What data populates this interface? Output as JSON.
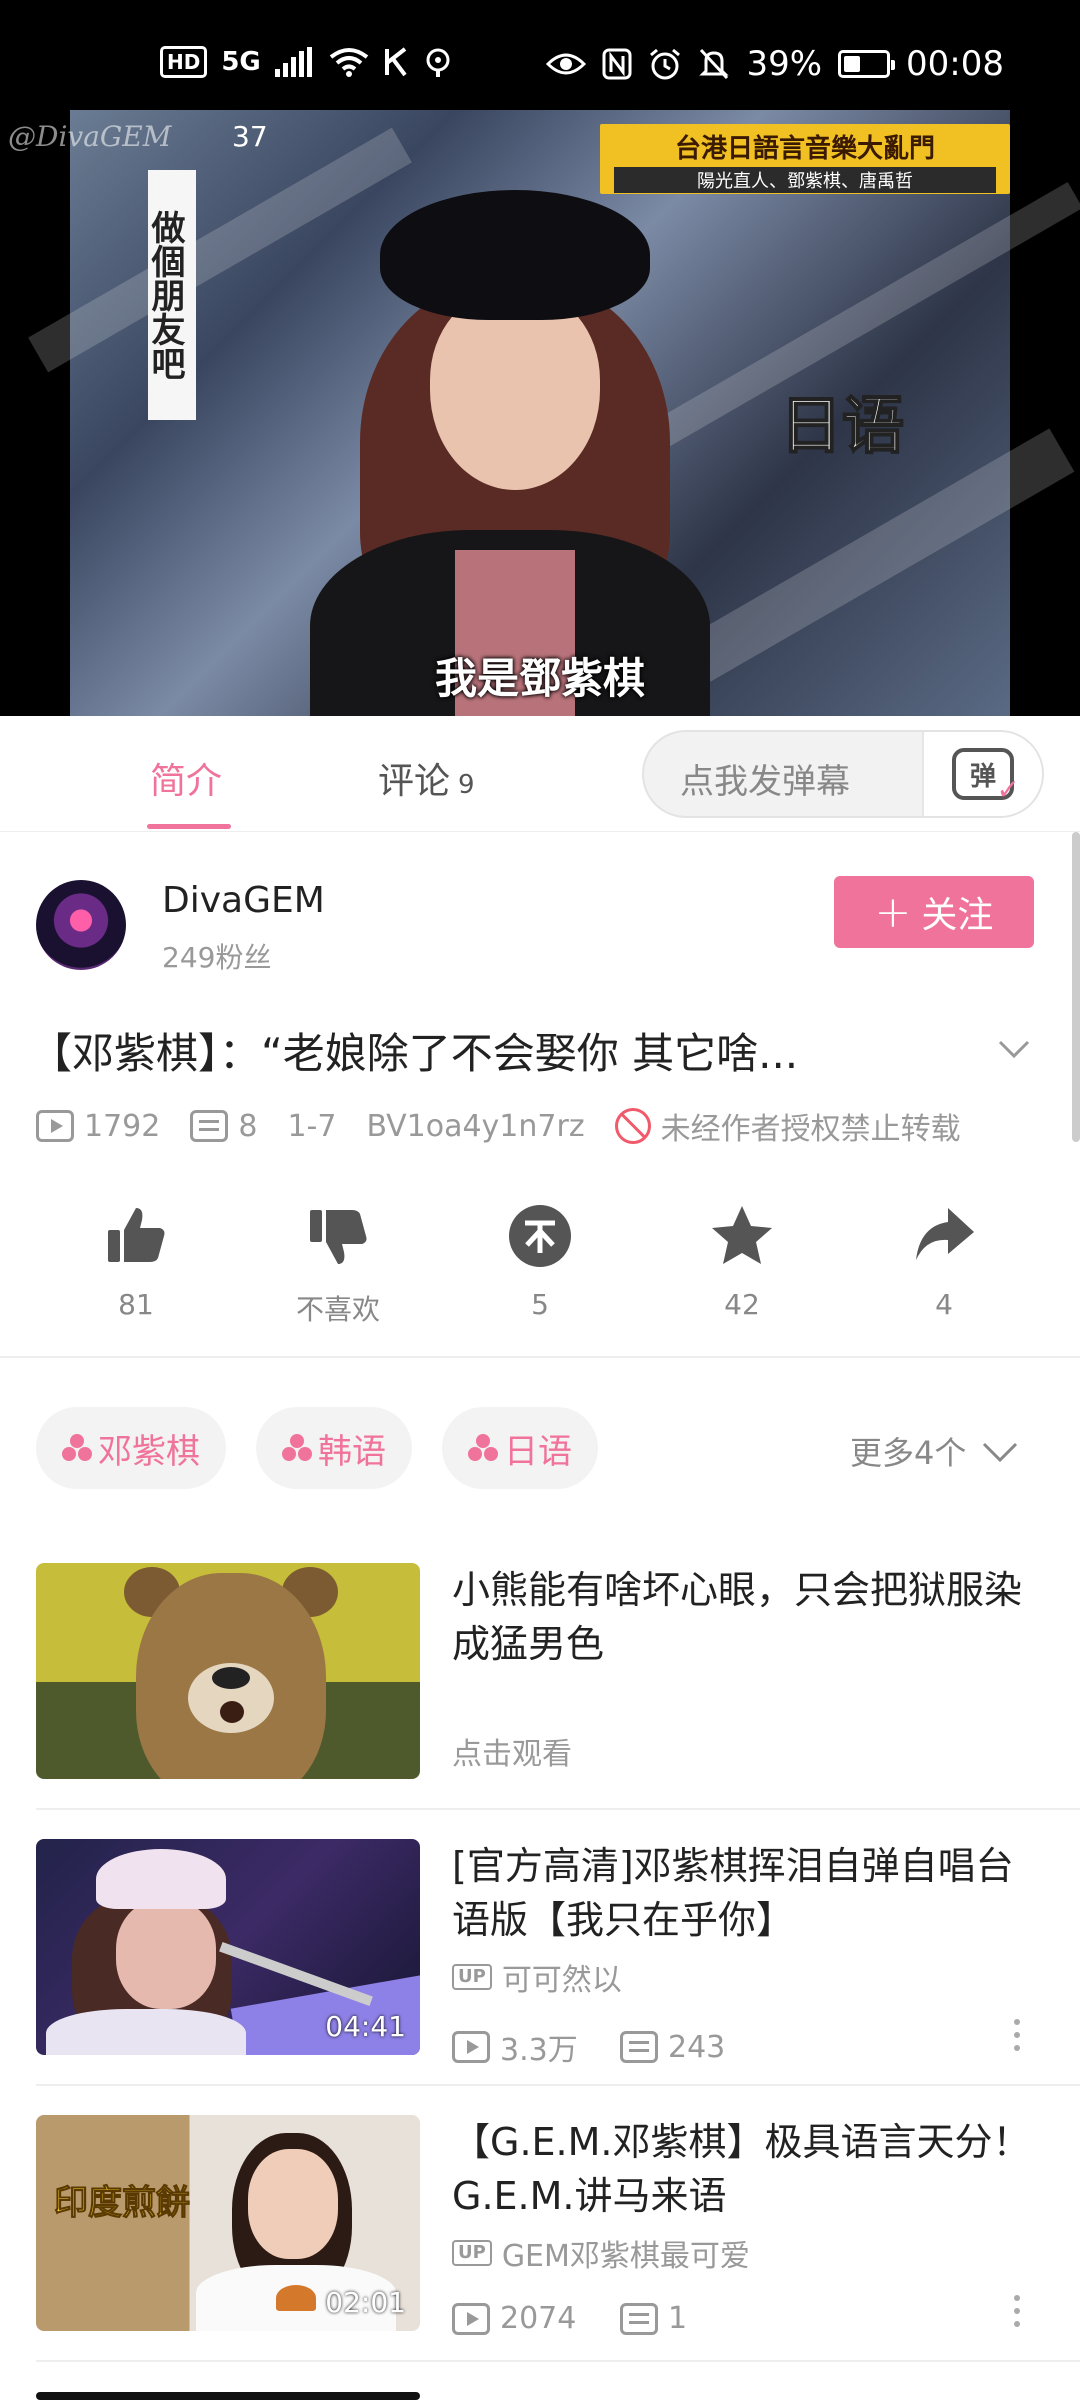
{
  "status_bar": {
    "network": "5G",
    "battery": "39%",
    "battery_level": 0.39,
    "time": "00:08"
  },
  "video": {
    "watermark": "@DivaGEM",
    "episode": "37",
    "banner_line1": "台港日語言音樂大亂門",
    "banner_line2": "陽光直人、鄧紫棋、唐禹哲",
    "vertical_caption": "做個朋友吧",
    "side_caption": "日语",
    "subtitle": "我是鄧紫棋"
  },
  "tabs": {
    "intro": "简介",
    "comments": "评论",
    "comments_count": "9",
    "danmu_placeholder": "点我发弹幕",
    "danmu_button_label": "弹"
  },
  "uploader": {
    "name": "DivaGEM",
    "fans": "249粉丝",
    "follow_label": "关注",
    "follow_plus": "+"
  },
  "video_info": {
    "title": "【邓紫棋】：“老娘除了不会娶你 其它啥...",
    "plays": "1792",
    "danmaku": "8",
    "date": "1-7",
    "bvid": "BV1oa4y1n7rz",
    "copyright": "未经作者授权禁止转载"
  },
  "actions": {
    "like": "81",
    "dislike": "不喜欢",
    "coin": "5",
    "favorite": "42",
    "share": "4"
  },
  "tags": {
    "items": [
      "邓紫棋",
      "韩语",
      "日语"
    ],
    "more": "更多4个"
  },
  "recommendations": [
    {
      "title": "小熊能有啥坏心眼，只会把狱服染成猛男色",
      "hint": "点击观看"
    },
    {
      "title": "[官方高清]邓紫棋挥泪自弹自唱台语版【我只在乎你】",
      "duration": "04:41",
      "up_badge": "UP",
      "up": "可可然以",
      "plays": "3.3万",
      "danmaku": "243"
    },
    {
      "title": "【G.E.M.邓紫棋】极具语言天分！G.E.M.讲马来语",
      "duration": "02:01",
      "thumb_label": "印度煎餅",
      "up_badge": "UP",
      "up": "GEM邓紫棋最可爱",
      "plays": "2074",
      "danmaku": "1"
    }
  ],
  "colors": {
    "accent": "#f0739b",
    "warning": "#f05a6a",
    "muted": "#999999"
  }
}
